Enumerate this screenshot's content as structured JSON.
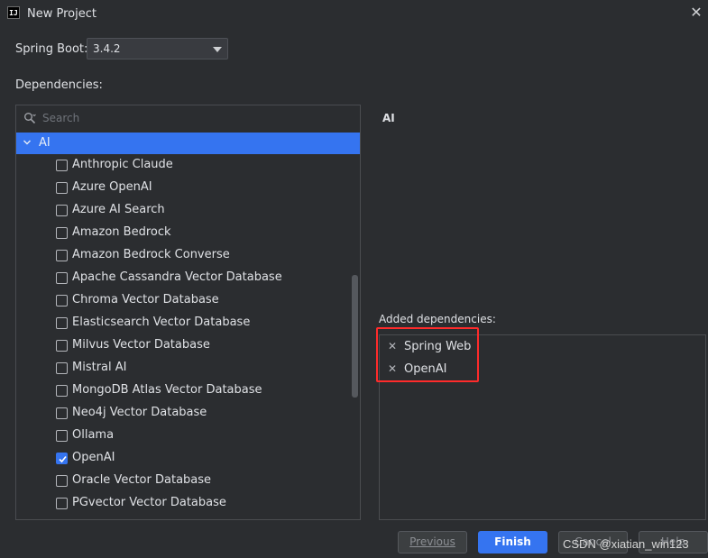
{
  "window": {
    "title": "New Project",
    "logo_text": "IJ"
  },
  "spring_boot": {
    "label": "Spring Boot:",
    "value": "3.4.2"
  },
  "dependencies": {
    "label": "Dependencies:",
    "search_placeholder": "Search",
    "group": "AI",
    "items": [
      {
        "label": "Anthropic Claude",
        "checked": false
      },
      {
        "label": "Azure OpenAI",
        "checked": false
      },
      {
        "label": "Azure AI Search",
        "checked": false
      },
      {
        "label": "Amazon Bedrock",
        "checked": false
      },
      {
        "label": "Amazon Bedrock Converse",
        "checked": false
      },
      {
        "label": "Apache Cassandra Vector Database",
        "checked": false
      },
      {
        "label": "Chroma Vector Database",
        "checked": false
      },
      {
        "label": "Elasticsearch Vector Database",
        "checked": false
      },
      {
        "label": "Milvus Vector Database",
        "checked": false
      },
      {
        "label": "Mistral AI",
        "checked": false
      },
      {
        "label": "MongoDB Atlas Vector Database",
        "checked": false
      },
      {
        "label": "Neo4j Vector Database",
        "checked": false
      },
      {
        "label": "Ollama",
        "checked": false
      },
      {
        "label": "OpenAI",
        "checked": true
      },
      {
        "label": "Oracle Vector Database",
        "checked": false
      },
      {
        "label": "PGvector Vector Database",
        "checked": false
      }
    ]
  },
  "detail": {
    "title": "AI"
  },
  "added": {
    "label": "Added dependencies:",
    "items": [
      "Spring Web",
      "OpenAI"
    ]
  },
  "buttons": {
    "previous": "Previous",
    "finish": "Finish",
    "cancel": "Cancel",
    "help": "Help"
  },
  "watermark": "CSDN @xiatian_win123",
  "colors": {
    "accent": "#3574f0",
    "background": "#2b2d30",
    "highlight": "#ff2b2b"
  }
}
